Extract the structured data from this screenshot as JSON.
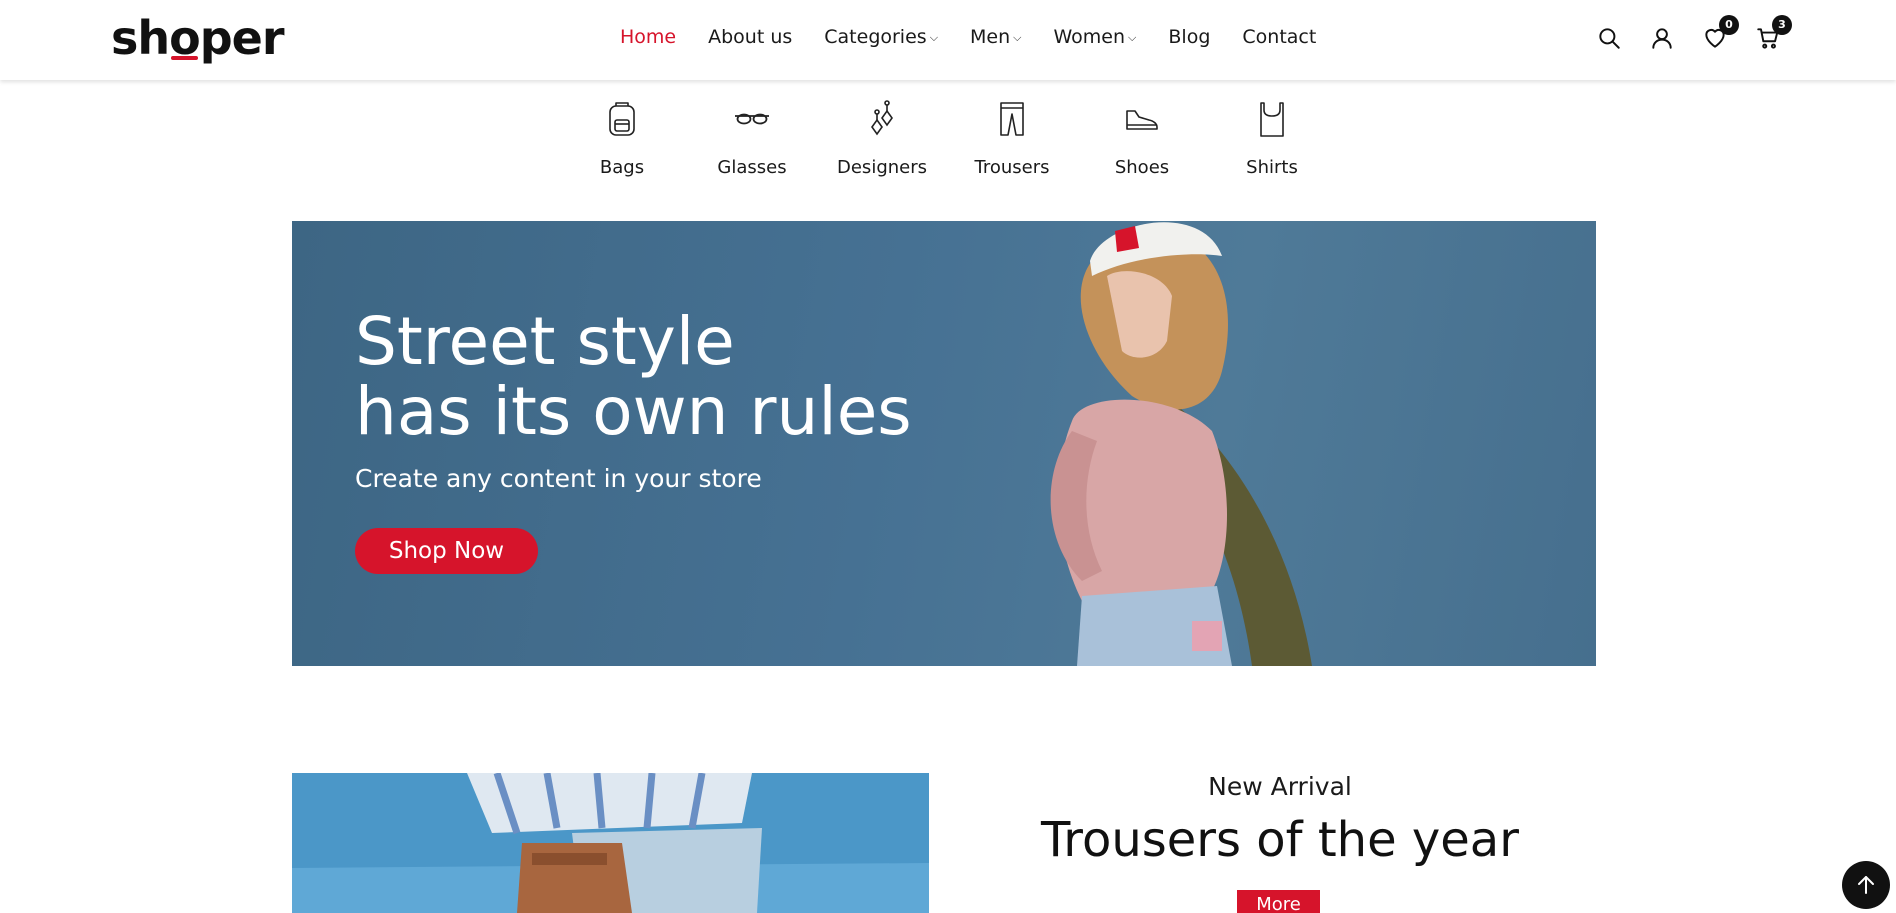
{
  "brand": {
    "logo_text_pre": "sh",
    "logo_text_o": "o",
    "logo_text_post": "per",
    "accent_color": "#d6142b"
  },
  "nav": {
    "items": [
      {
        "label": "Home",
        "active": true
      },
      {
        "label": "About us"
      },
      {
        "label": "Categories",
        "dropdown": true
      },
      {
        "label": "Men",
        "dropdown": true
      },
      {
        "label": "Women",
        "dropdown": true
      },
      {
        "label": "Blog"
      },
      {
        "label": "Contact"
      }
    ]
  },
  "header_icons": {
    "search": "search-icon",
    "account": "user-icon",
    "wishlist": {
      "icon": "heart-icon",
      "count": "0"
    },
    "cart": {
      "icon": "cart-icon",
      "count": "3"
    }
  },
  "categories": [
    {
      "label": "Bags",
      "icon": "backpack-icon"
    },
    {
      "label": "Glasses",
      "icon": "glasses-icon"
    },
    {
      "label": "Designers",
      "icon": "earrings-icon"
    },
    {
      "label": "Trousers",
      "icon": "trousers-icon"
    },
    {
      "label": "Shoes",
      "icon": "shoe-icon"
    },
    {
      "label": "Shirts",
      "icon": "shirt-icon"
    }
  ],
  "hero": {
    "title_line1": "Street style",
    "title_line2": "has its own rules",
    "subtitle": "Create any content in your store",
    "button": "Shop Now"
  },
  "arrival": {
    "kicker": "New Arrival",
    "title": "Trousers of the year",
    "button": "More"
  }
}
